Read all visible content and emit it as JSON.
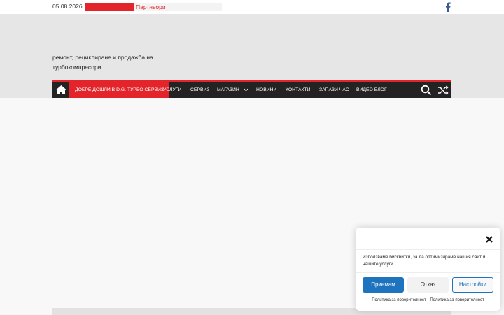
{
  "topbar": {
    "date": "05.08.2026",
    "ticker_text": "Партньори",
    "facebook_icon": "facebook-icon"
  },
  "header": {
    "tagline": "ремонт, рециклиране и продажба на турбокомпресори"
  },
  "nav": {
    "home_icon": "home-icon",
    "items": [
      {
        "label": "ДОБРЕ ДОШЛИ В D.G. ТУРБО СЕРВИЗ",
        "active": true
      },
      {
        "label": "УСЛУГИ"
      },
      {
        "label": "СЕРВИЗ"
      },
      {
        "label": "МАГАЗИН",
        "has_dropdown": true
      },
      {
        "label": "НОВИНИ"
      },
      {
        "label": "КОНТАКТИ"
      },
      {
        "label": "ЗАПАЗИ ЧАС"
      },
      {
        "label": "ВИДЕО БЛОГ"
      }
    ],
    "search_icon": "search-icon",
    "random_icon": "shuffle-icon"
  },
  "cookie": {
    "message": "Използваме бисквитки, за да оптимизираме нашия сайт и нашите услуги.",
    "accept": "Приемам",
    "deny": "Отказ",
    "settings": "Настройки",
    "link1": "Политика за поверителност",
    "link2": "Политика за поверителност"
  },
  "colors": {
    "accent": "#e3242b",
    "nav_bg": "#232323",
    "accept_blue": "#1e73be"
  }
}
